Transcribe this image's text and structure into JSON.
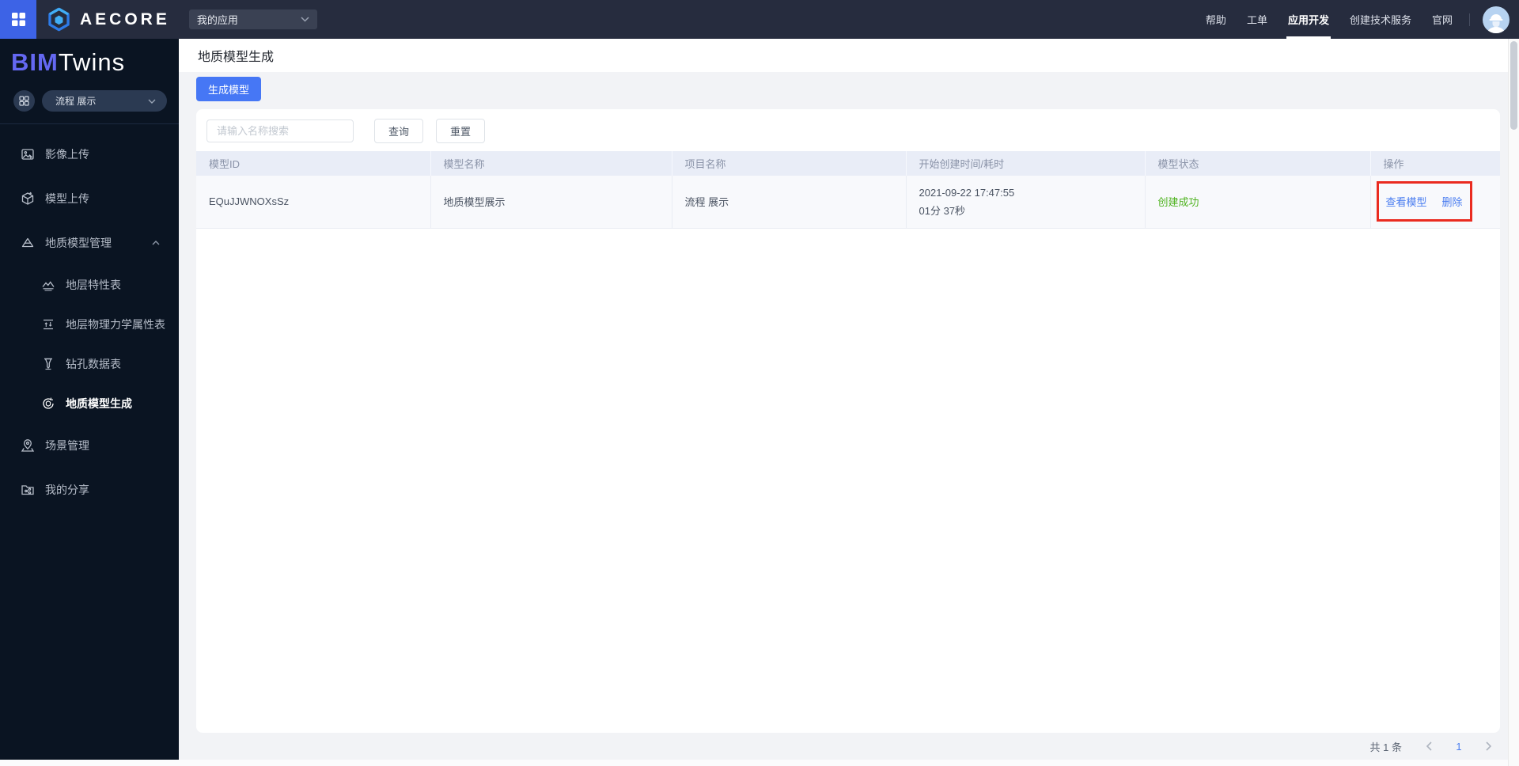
{
  "topbar": {
    "brand": "AECORE",
    "app_select": {
      "value": "我的应用"
    },
    "nav": [
      {
        "label": "帮助"
      },
      {
        "label": "工单"
      },
      {
        "label": "应用开发"
      },
      {
        "label": "创建技术服务"
      },
      {
        "label": "官网"
      }
    ]
  },
  "sidebar": {
    "logo_prefix": "BIM",
    "logo_suffix": "Twins",
    "project_select": {
      "value": "流程 展示"
    },
    "menu": [
      {
        "label": "影像上传"
      },
      {
        "label": "模型上传"
      },
      {
        "label": "地质模型管理",
        "expanded": true,
        "children": [
          {
            "label": "地层特性表"
          },
          {
            "label": "地层物理力学属性表"
          },
          {
            "label": "钻孔数据表"
          },
          {
            "label": "地质模型生成",
            "active": true
          }
        ]
      },
      {
        "label": "场景管理"
      },
      {
        "label": "我的分享"
      }
    ]
  },
  "page": {
    "title": "地质模型生成",
    "generate_button": "生成模型",
    "search_placeholder": "请输入名称搜索",
    "query_button": "查询",
    "reset_button": "重置"
  },
  "table": {
    "columns": [
      "模型ID",
      "模型名称",
      "项目名称",
      "开始创建时间/耗时",
      "模型状态",
      "操作"
    ],
    "rows": [
      {
        "model_id": "EQuJJWNOXsSz",
        "model_name": "地质模型展示",
        "project_name": "流程 展示",
        "start_time": "2021-09-22 17:47:55",
        "duration": "01分 37秒",
        "status": "创建成功",
        "action_view": "查看模型",
        "action_delete": "删除"
      }
    ]
  },
  "pagination": {
    "total_text": "共 1 条",
    "current_page": "1"
  },
  "colors": {
    "accent_blue": "#4677f5",
    "link_blue": "#4a7df0",
    "status_green": "#4fb320",
    "annotation_red": "#ea2b20",
    "topbar_bg": "#262c3e",
    "sidebar_bg": "#0a1422",
    "table_header_bg": "#e9edf7"
  }
}
